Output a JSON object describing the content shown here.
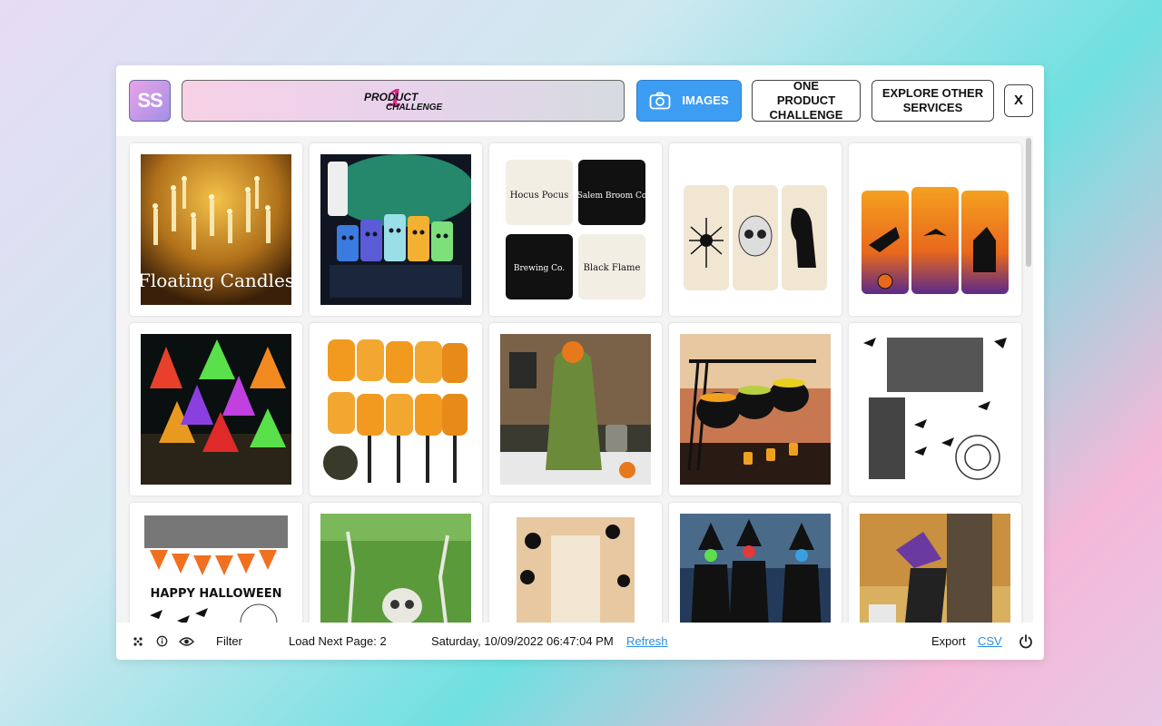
{
  "header": {
    "logo_text": "SS",
    "banner": {
      "line1": "PRODUCT",
      "line2": "CHALLENGE",
      "numeral": "1"
    },
    "images_button": "IMAGES",
    "one_product_button": "ONE PRODUCT CHALLENGE",
    "explore_button": "EXPLORE OTHER SERVICES",
    "close_button": "X"
  },
  "products": [
    {
      "name": "floating-candles",
      "caption": "Floating Candles"
    },
    {
      "name": "led-pumpkin-candles"
    },
    {
      "name": "halloween-pillow-covers",
      "captions": [
        "Hocus Pocus",
        "Salem Broom Co",
        "Brewing Co.",
        "Black Flame"
      ]
    },
    {
      "name": "spider-skull-raven-candles"
    },
    {
      "name": "witch-bat-candles"
    },
    {
      "name": "hanging-witch-hats"
    },
    {
      "name": "flame-torch-lights"
    },
    {
      "name": "hanging-reaper-ghost"
    },
    {
      "name": "cauldron-serving-stand"
    },
    {
      "name": "spider-web-lace-decor"
    },
    {
      "name": "happy-halloween-banner",
      "caption": "HAPPY HALLOWEEN"
    },
    {
      "name": "skeleton-ground-stakes"
    },
    {
      "name": "spider-door-decor"
    },
    {
      "name": "glowing-witch-figures"
    },
    {
      "name": "crashing-witch-tree"
    }
  ],
  "footer": {
    "filter_label": "Filter",
    "load_next_label": "Load Next Page: 2",
    "datetime": "Saturday, 10/09/2022 06:47:04 PM",
    "refresh_label": "Refresh",
    "export_label": "Export",
    "csv_label": "CSV"
  },
  "colors": {
    "accent": "#3d9df2",
    "link": "#2a8fe0"
  }
}
